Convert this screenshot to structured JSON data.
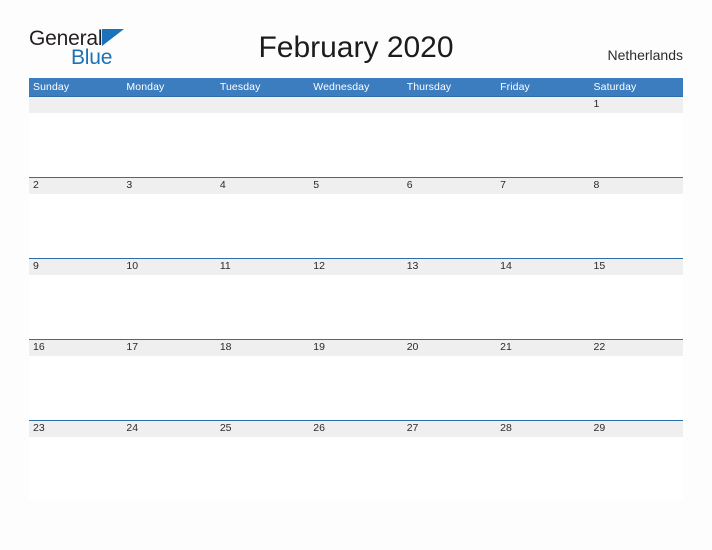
{
  "logo": {
    "word1": "General",
    "word2": "Blue",
    "flag_icon": "blue-triangle-flag-icon",
    "color_dark": "#231f20",
    "color_blue": "#1b72b8"
  },
  "header": {
    "title": "February 2020",
    "country": "Netherlands"
  },
  "calendar": {
    "accent_header_color": "#3c7dc0",
    "date_band_color": "#efefef",
    "rule_color": "#2f6fa8",
    "weekdays": [
      "Sunday",
      "Monday",
      "Tuesday",
      "Wednesday",
      "Thursday",
      "Friday",
      "Saturday"
    ],
    "weeks": [
      [
        "",
        "",
        "",
        "",
        "",
        "",
        "1"
      ],
      [
        "2",
        "3",
        "4",
        "5",
        "6",
        "7",
        "8"
      ],
      [
        "9",
        "10",
        "11",
        "12",
        "13",
        "14",
        "15"
      ],
      [
        "16",
        "17",
        "18",
        "19",
        "20",
        "21",
        "22"
      ],
      [
        "23",
        "24",
        "25",
        "26",
        "27",
        "28",
        "29"
      ]
    ]
  }
}
